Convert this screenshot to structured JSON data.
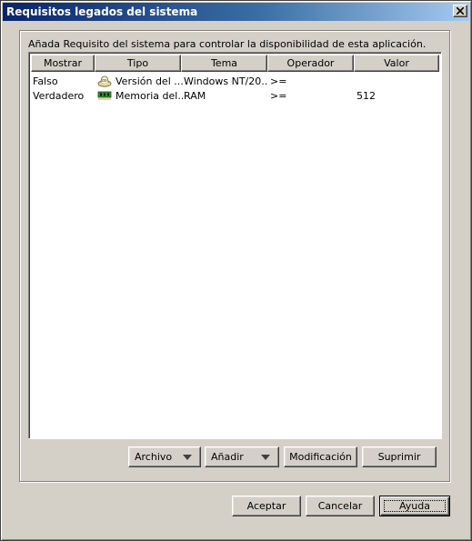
{
  "window": {
    "title": "Requisitos legados del sistema"
  },
  "description": "Añada Requisito del sistema para controlar la disponibilidad de esta aplicación.",
  "table": {
    "columns": [
      "Mostrar",
      "Tipo",
      "Tema",
      "Operador",
      "Valor"
    ],
    "rows": [
      {
        "mostrar": "Falso",
        "type_icon": "os-version-icon",
        "tipo": "Versión del ...",
        "tema": "Windows NT/20...",
        "operador": ">=",
        "valor": ""
      },
      {
        "mostrar": "Verdadero",
        "type_icon": "memory-chip-icon",
        "tipo": "Memoria del...",
        "tema": "RAM",
        "operador": ">=",
        "valor": "512"
      }
    ]
  },
  "list_buttons": {
    "archivo": "Archivo",
    "anadir": "Añadir",
    "modificacion": "Modificación",
    "suprimir": "Suprimir"
  },
  "dialog_buttons": {
    "aceptar": "Aceptar",
    "cancelar": "Cancelar",
    "ayuda": "Ayuda"
  }
}
